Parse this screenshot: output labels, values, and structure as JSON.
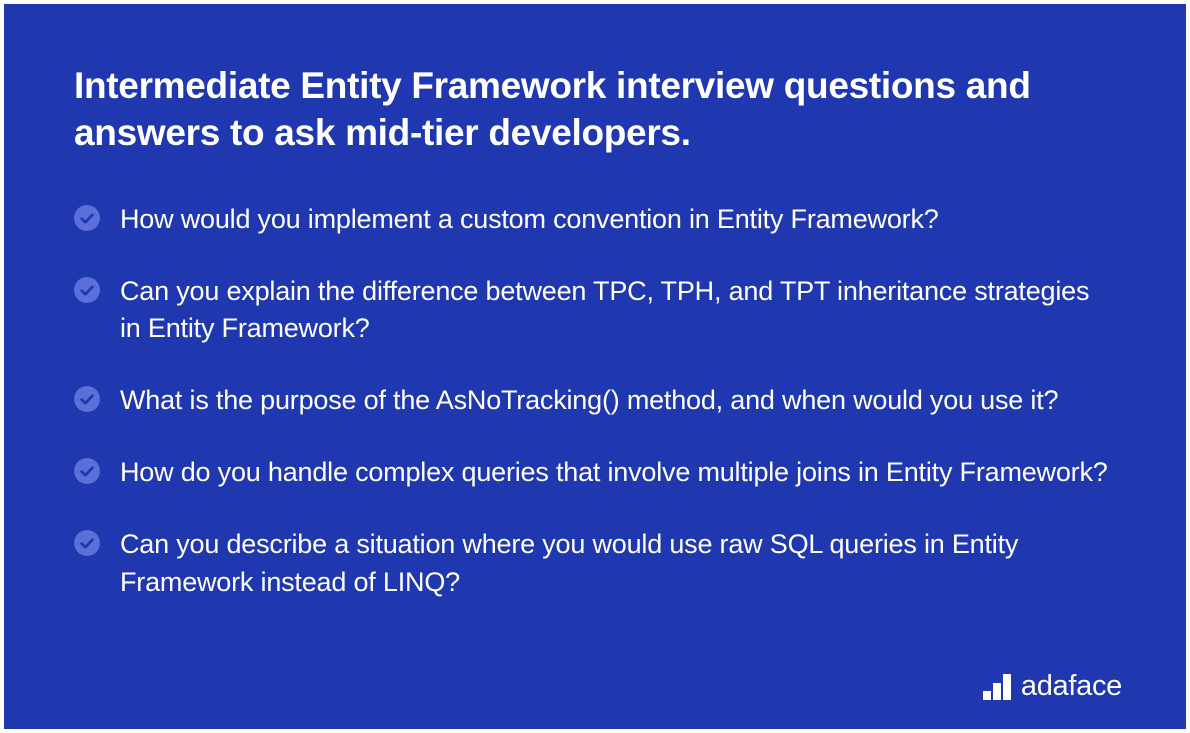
{
  "heading": "Intermediate Entity Framework interview questions and answers to ask mid-tier developers.",
  "questions": [
    "How would you implement a custom convention in Entity Framework?",
    "Can you explain the difference between TPC, TPH, and TPT inheritance strategies in Entity Framework?",
    "What is the purpose of the AsNoTracking() method, and when would you use it?",
    "How do you handle complex queries that involve multiple joins in Entity Framework?",
    "Can you describe a situation where you would use raw SQL queries in Entity Framework instead of LINQ?"
  ],
  "brand": {
    "name": "adaface"
  },
  "colors": {
    "background": "#1f37af",
    "text": "#ffffff",
    "iconFill": "#5a6fd8"
  }
}
